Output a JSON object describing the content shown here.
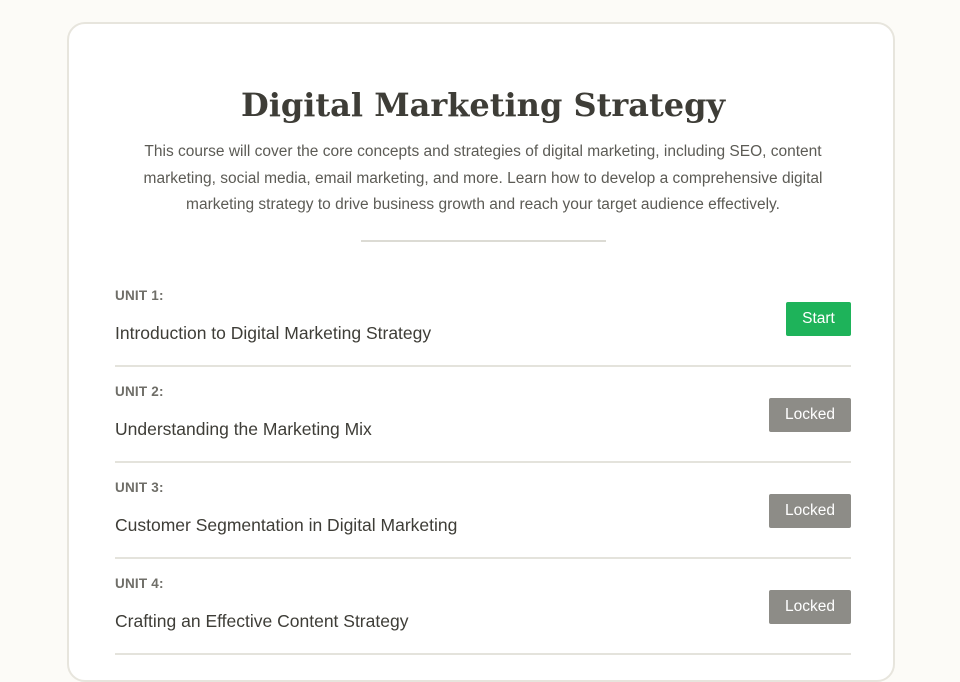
{
  "course": {
    "title": "Digital Marketing Strategy",
    "description": "This course will cover the core concepts and strategies of digital marketing, including SEO, content marketing, social media, email marketing, and more. Learn how to develop a comprehensive digital marketing strategy to drive business growth and reach your target audience effectively."
  },
  "units": [
    {
      "label": "UNIT 1:",
      "title": "Introduction to Digital Marketing Strategy",
      "button": "Start"
    },
    {
      "label": "UNIT 2:",
      "title": "Understanding the Marketing Mix",
      "button": "Locked"
    },
    {
      "label": "UNIT 3:",
      "title": "Customer Segmentation in Digital Marketing",
      "button": "Locked"
    },
    {
      "label": "UNIT 4:",
      "title": "Crafting an Effective Content Strategy",
      "button": "Locked"
    }
  ],
  "colors": {
    "start_button": "#1eb35a",
    "locked_button": "#8d8c87",
    "background": "#fcfbf7"
  }
}
